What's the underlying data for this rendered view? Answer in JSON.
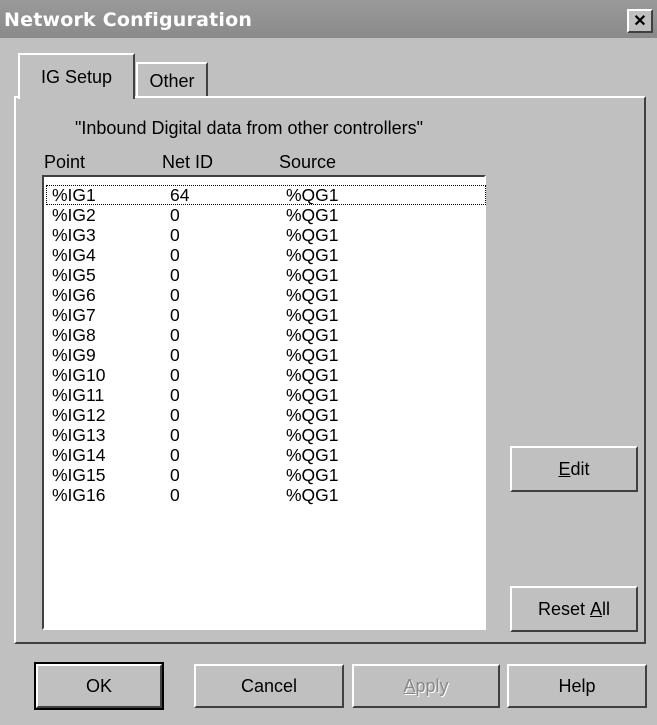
{
  "window": {
    "title": "Network Configuration",
    "close_glyph": "✕"
  },
  "tabs": [
    {
      "label": "IG Setup"
    },
    {
      "label": "Other"
    }
  ],
  "panel": {
    "heading": "\"Inbound Digital data from other controllers\"",
    "columns": [
      "Point",
      "Net ID",
      "Source"
    ],
    "rows": [
      {
        "point": "%IG1",
        "net_id": "64",
        "source": "%QG1"
      },
      {
        "point": "%IG2",
        "net_id": "0",
        "source": "%QG1"
      },
      {
        "point": "%IG3",
        "net_id": "0",
        "source": "%QG1"
      },
      {
        "point": "%IG4",
        "net_id": "0",
        "source": "%QG1"
      },
      {
        "point": "%IG5",
        "net_id": "0",
        "source": "%QG1"
      },
      {
        "point": "%IG6",
        "net_id": "0",
        "source": "%QG1"
      },
      {
        "point": "%IG7",
        "net_id": "0",
        "source": "%QG1"
      },
      {
        "point": "%IG8",
        "net_id": "0",
        "source": "%QG1"
      },
      {
        "point": "%IG9",
        "net_id": "0",
        "source": "%QG1"
      },
      {
        "point": "%IG10",
        "net_id": "0",
        "source": "%QG1"
      },
      {
        "point": "%IG11",
        "net_id": "0",
        "source": "%QG1"
      },
      {
        "point": "%IG12",
        "net_id": "0",
        "source": "%QG1"
      },
      {
        "point": "%IG13",
        "net_id": "0",
        "source": "%QG1"
      },
      {
        "point": "%IG14",
        "net_id": "0",
        "source": "%QG1"
      },
      {
        "point": "%IG15",
        "net_id": "0",
        "source": "%QG1"
      },
      {
        "point": "%IG16",
        "net_id": "0",
        "source": "%QG1"
      }
    ],
    "edit_label_mnemonic": "E",
    "edit_label_rest": "dit",
    "reset_label_prefix": "Reset ",
    "reset_label_mnemonic": "A",
    "reset_label_rest": "ll"
  },
  "footer": {
    "ok": "OK",
    "cancel": "Cancel",
    "apply_mnemonic": "A",
    "apply_rest": "pply",
    "help": "Help"
  }
}
